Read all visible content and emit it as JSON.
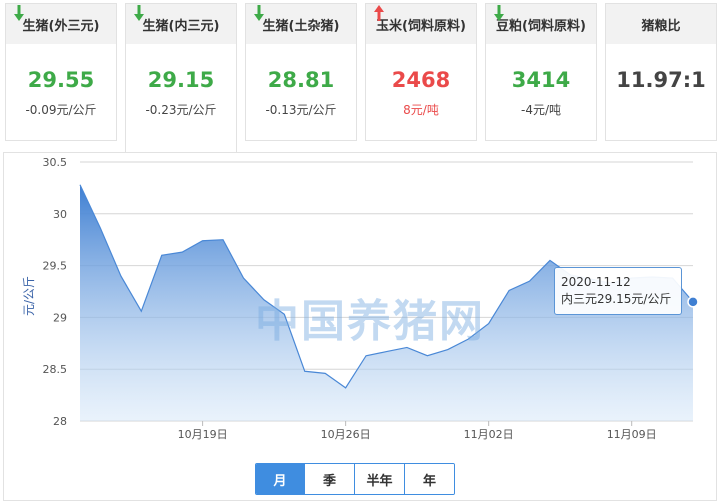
{
  "cards": [
    {
      "title": "生猪(外三元)",
      "value": "29.55",
      "direction": "down",
      "change": "-0.09元/公斤"
    },
    {
      "title": "生猪(内三元)",
      "value": "29.15",
      "direction": "down",
      "change": "-0.23元/公斤"
    },
    {
      "title": "生猪(土杂猪)",
      "value": "28.81",
      "direction": "down",
      "change": "-0.13元/公斤"
    },
    {
      "title": "玉米(饲料原料)",
      "value": "2468",
      "direction": "up",
      "change": "8元/吨"
    },
    {
      "title": "豆粕(饲料原料)",
      "value": "3414",
      "direction": "down",
      "change": "-4元/吨"
    },
    {
      "title": "猪粮比",
      "value": "11.97:1"
    }
  ],
  "colors": {
    "up": "#ea4a4a",
    "down": "#3eaa48",
    "accent": "#3f8de0"
  },
  "watermark": "中国养猪网",
  "tooltip": {
    "date": "2020-11-12",
    "text": "内三元29.15元/公斤"
  },
  "periods": [
    "月",
    "季",
    "半年",
    "年"
  ],
  "active_period": "月",
  "chart_data": {
    "type": "area",
    "ylabel": "元/公斤",
    "ylim": [
      28,
      30.5
    ],
    "yticks": [
      28,
      28.5,
      29,
      29.5,
      30,
      30.5
    ],
    "xtick_labels": [
      "10月19日",
      "10月26日",
      "11月02日",
      "11月09日"
    ],
    "x": [
      "2020-10-13",
      "2020-10-14",
      "2020-10-15",
      "2020-10-16",
      "2020-10-17",
      "2020-10-18",
      "2020-10-19",
      "2020-10-20",
      "2020-10-21",
      "2020-10-22",
      "2020-10-23",
      "2020-10-24",
      "2020-10-25",
      "2020-10-26",
      "2020-10-27",
      "2020-10-28",
      "2020-10-29",
      "2020-10-30",
      "2020-10-31",
      "2020-11-01",
      "2020-11-02",
      "2020-11-03",
      "2020-11-04",
      "2020-11-05",
      "2020-11-06",
      "2020-11-07",
      "2020-11-08",
      "2020-11-09",
      "2020-11-10",
      "2020-11-11",
      "2020-11-12"
    ],
    "series": [
      {
        "name": "内三元",
        "values": [
          30.28,
          29.86,
          29.4,
          29.06,
          29.6,
          29.63,
          29.74,
          29.75,
          29.38,
          29.17,
          29.03,
          28.48,
          28.46,
          28.32,
          28.63,
          28.67,
          28.71,
          28.63,
          28.69,
          28.79,
          28.94,
          29.26,
          29.35,
          29.55,
          29.41,
          29.37,
          29.33,
          29.38,
          29.39,
          29.38,
          29.15
        ]
      }
    ],
    "grid": true,
    "legend": "none"
  }
}
